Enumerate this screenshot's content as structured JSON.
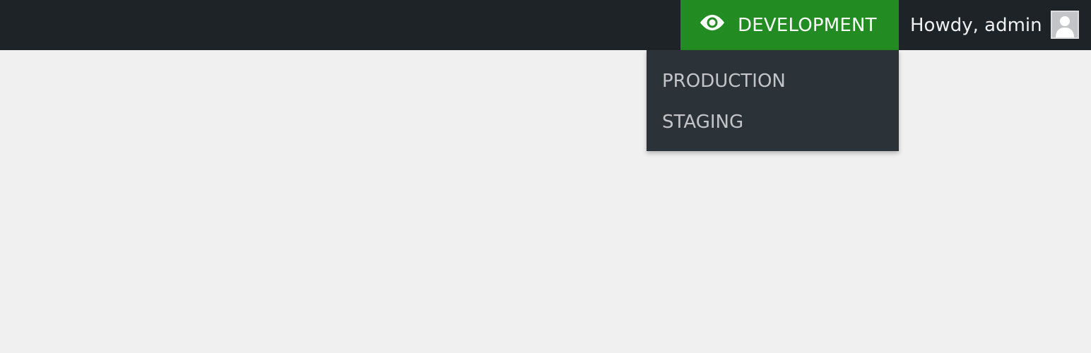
{
  "admin_bar": {
    "environment": {
      "icon": "eye-icon",
      "label": "DEVELOPMENT",
      "color": "#228b22"
    },
    "account": {
      "greeting": "Howdy, admin",
      "avatar_icon": "user-avatar-icon"
    }
  },
  "environment_menu": {
    "items": [
      {
        "label": "PRODUCTION"
      },
      {
        "label": "STAGING"
      }
    ]
  },
  "colors": {
    "admin_bar_bg": "#1d2327",
    "menu_bg": "#2c3338",
    "menu_text": "#c3c4c7",
    "page_bg": "#f0f0f1"
  }
}
